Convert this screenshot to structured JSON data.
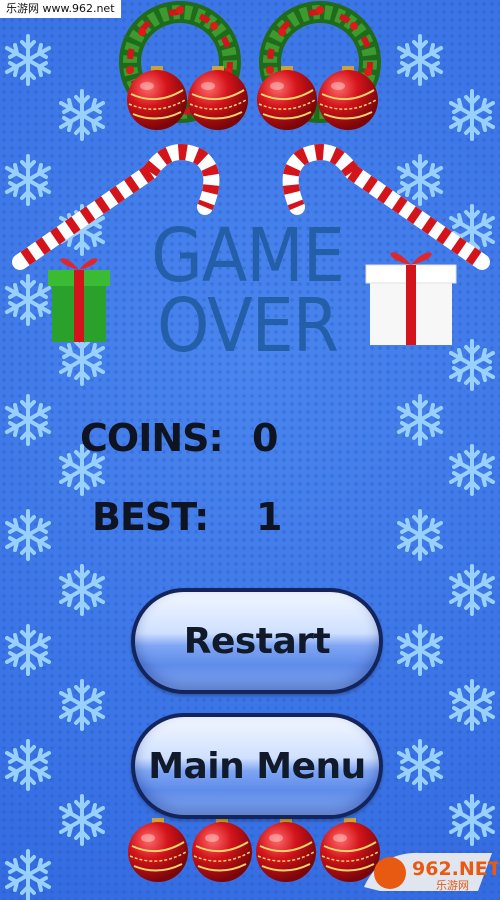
{
  "watermark": {
    "top_text": "乐游网 www.962.net",
    "bottom_logo_text": "962.NET",
    "bottom_logo_sub": "乐游网"
  },
  "title": {
    "line1": "GAME",
    "line2": "OVER"
  },
  "stats": {
    "coins_label": "COINS:",
    "coins_value": "0",
    "best_label": "BEST:",
    "best_value": "1"
  },
  "buttons": {
    "restart_label": "Restart",
    "main_menu_label": "Main Menu"
  },
  "colors": {
    "background": "#3c76e6",
    "title": "#1f5a9e",
    "snowflake": "#9fd6ff",
    "ornament_red": "#d11a1f",
    "wreath_green": "#2f8a2a"
  },
  "icons": [
    "wreath-icon",
    "candy-cane-icon",
    "gift-box-icon",
    "ornament-icon",
    "snowflake-icon"
  ]
}
